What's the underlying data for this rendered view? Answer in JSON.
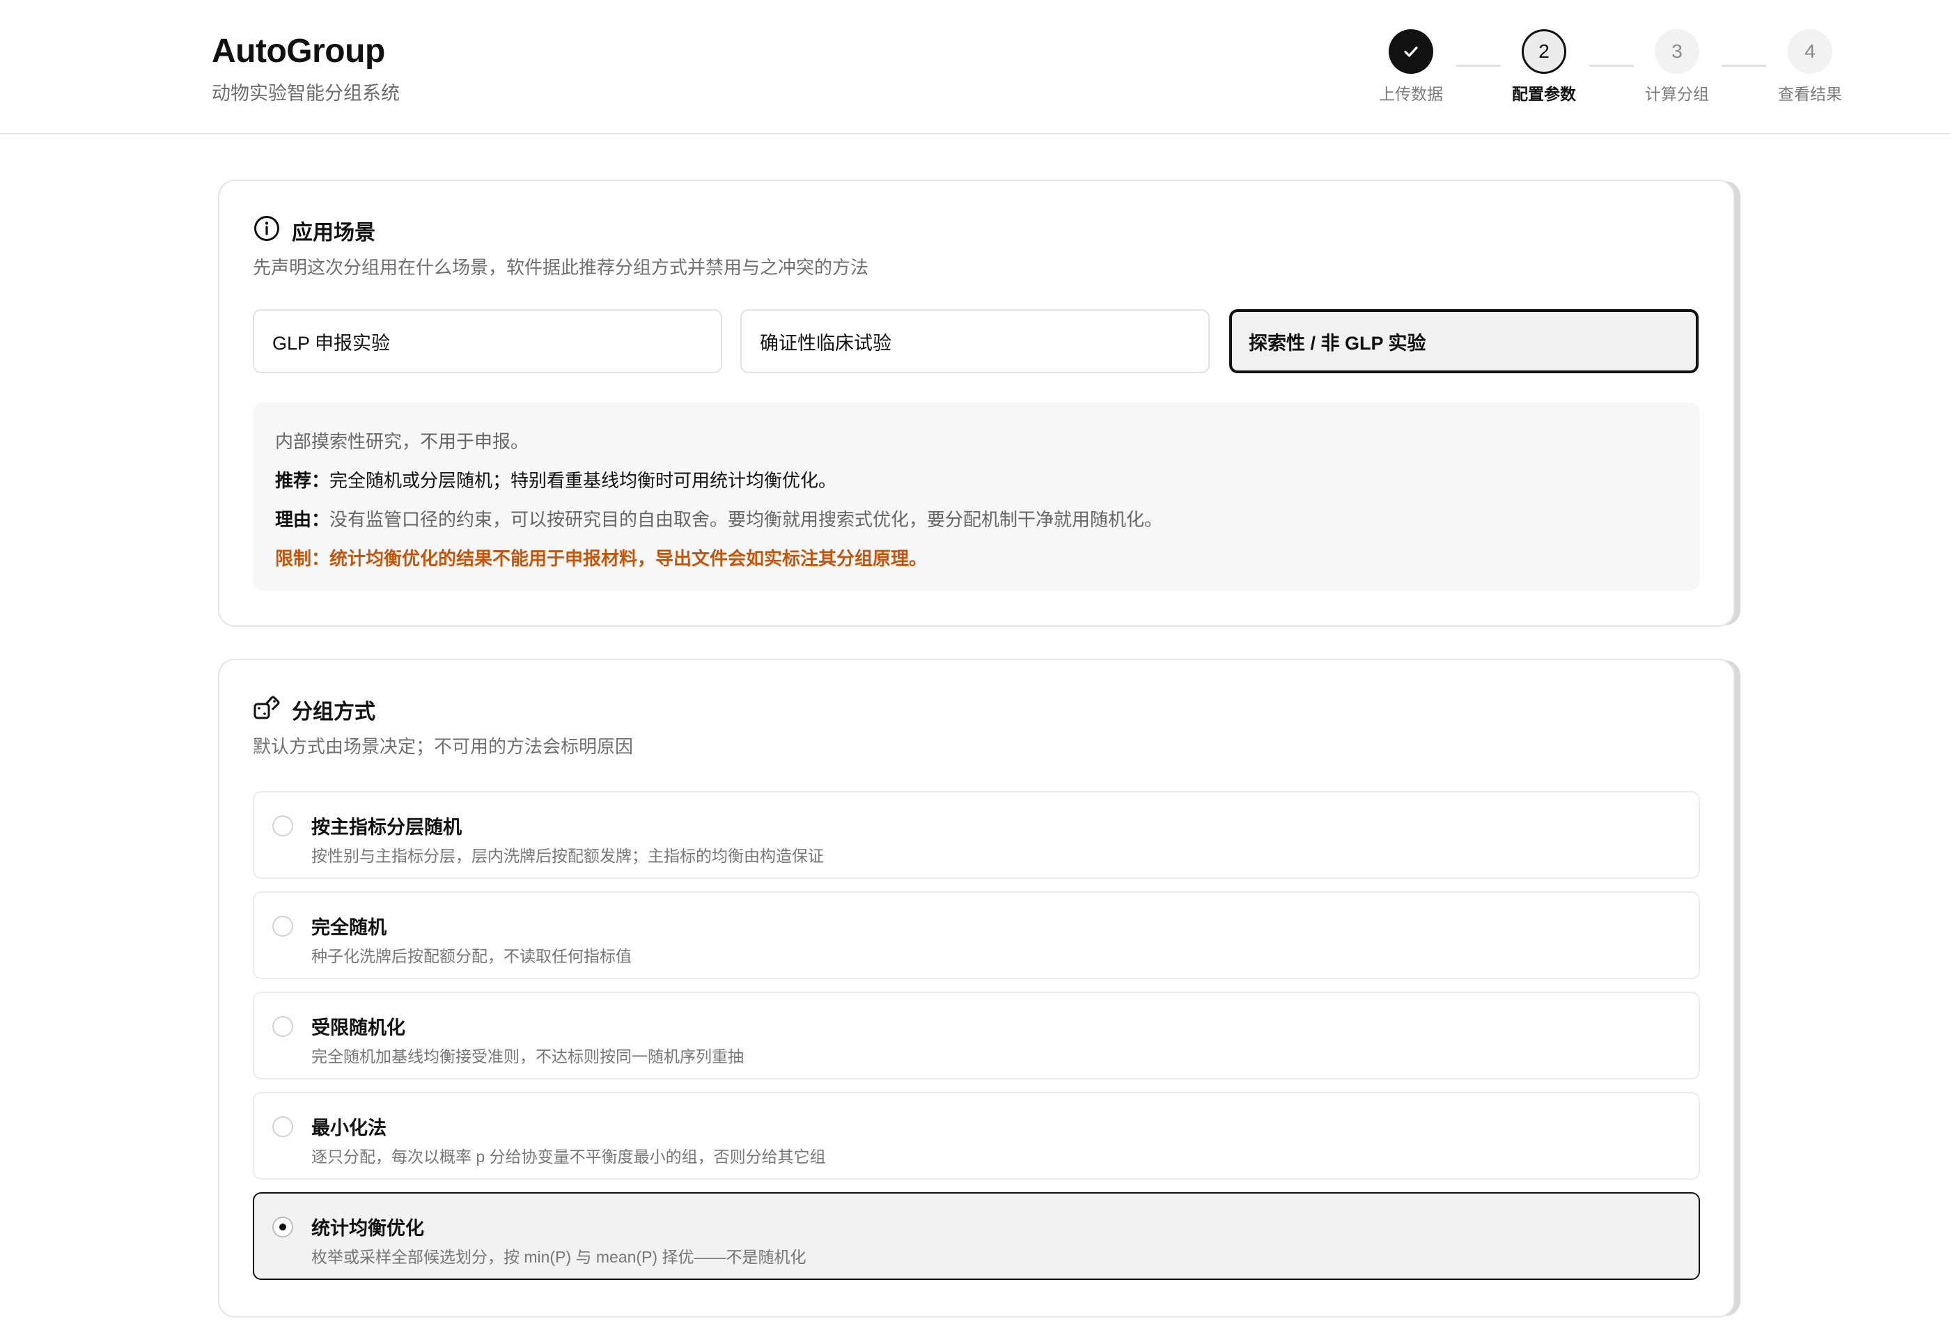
{
  "app": {
    "title": "AutoGroup",
    "subtitle": "动物实验智能分组系统"
  },
  "stepper": {
    "steps": [
      {
        "number": "✓",
        "label": "上传数据",
        "state": "done"
      },
      {
        "number": "2",
        "label": "配置参数",
        "state": "active"
      },
      {
        "number": "3",
        "label": "计算分组",
        "state": "todo"
      },
      {
        "number": "4",
        "label": "查看结果",
        "state": "todo"
      }
    ]
  },
  "scenario": {
    "title": "应用场景",
    "description": "先声明这次分组用在什么场景，软件据此推荐分组方式并禁用与之冲突的方法",
    "options": [
      "GLP 申报实验",
      "确证性临床试验",
      "探索性 / 非 GLP 实验"
    ],
    "selected_index": 2,
    "info": {
      "summary": "内部摸索性研究，不用于申报。",
      "recommend_label": "推荐：",
      "recommend_text": "完全随机或分层随机；特别看重基线均衡时可用统计均衡优化。",
      "reason_label": "理由：",
      "reason_text": "没有监管口径的约束，可以按研究目的自由取舍。要均衡就用搜索式优化，要分配机制干净就用随机化。",
      "limit_label": "限制：",
      "limit_text": "统计均衡优化的结果不能用于申报材料，导出文件会如实标注其分组原理。"
    }
  },
  "method": {
    "title": "分组方式",
    "description": "默认方式由场景决定；不可用的方法会标明原因",
    "options": [
      {
        "name": "按主指标分层随机",
        "desc": "按性别与主指标分层，层内洗牌后按配额发牌；主指标的均衡由构造保证"
      },
      {
        "name": "完全随机",
        "desc": "种子化洗牌后按配额分配，不读取任何指标值"
      },
      {
        "name": "受限随机化",
        "desc": "完全随机加基线均衡接受准则，不达标则按同一随机序列重抽"
      },
      {
        "name": "最小化法",
        "desc": "逐只分配，每次以概率 p 分给协变量不平衡度最小的组，否则分给其它组"
      },
      {
        "name": "统计均衡优化",
        "desc": "枚举或采样全部候选划分，按 min(P) 与 mean(P) 择优——不是随机化"
      }
    ],
    "selected_index": 4
  },
  "colors": {
    "accent": "#111111",
    "warning": "#c2560c",
    "muted_text": "#707070",
    "info_bg": "#f7f7f7"
  },
  "icons": {
    "scenario": "info-icon",
    "method": "dice-icon",
    "done_step": "check-icon"
  }
}
